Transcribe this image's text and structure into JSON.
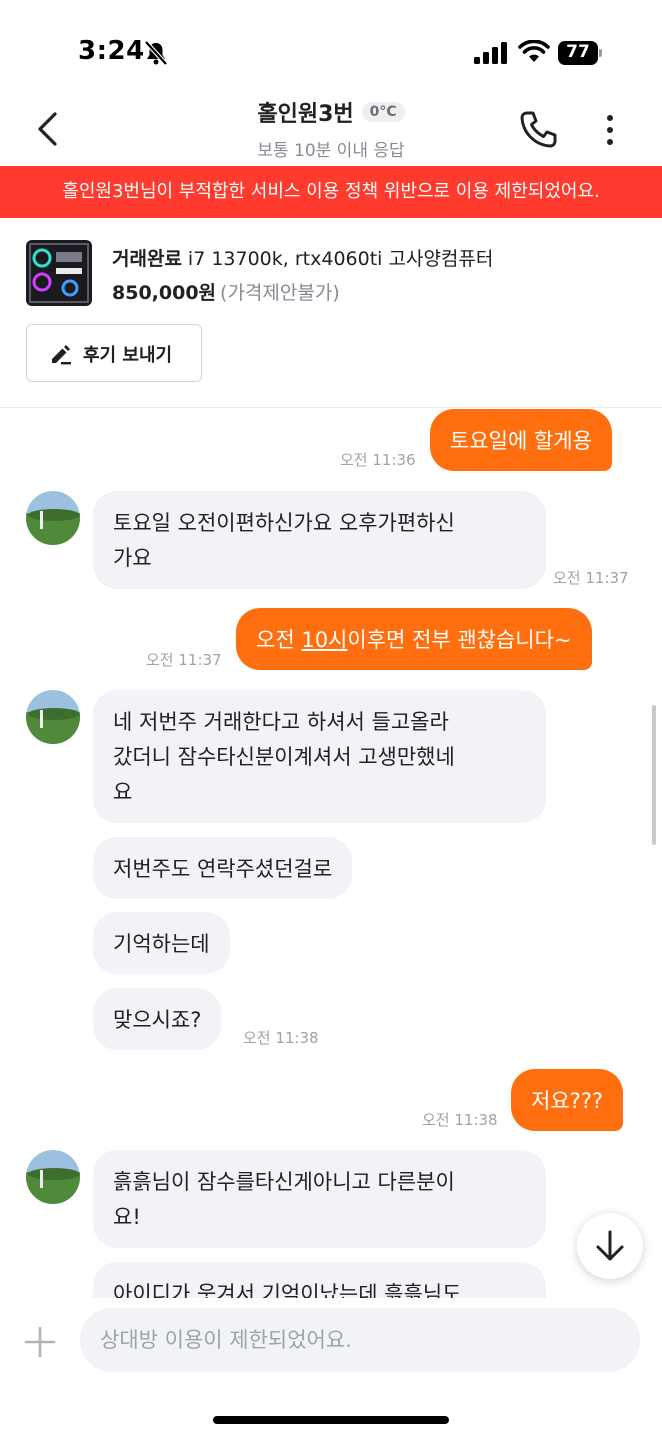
{
  "status_bar": {
    "time": "3:24",
    "battery": "77",
    "icons": [
      "bell-off-icon",
      "signal-icon",
      "wifi-icon",
      "battery-icon"
    ]
  },
  "header": {
    "title": "홀인원3번",
    "temperature": "0°C",
    "subtitle": "보통 10분 이내 응답",
    "icons": [
      "back-icon",
      "phone-icon",
      "more-vertical-icon"
    ]
  },
  "banner": {
    "text": "홀인원3번님이 부적합한 서비스 이용 정책 위반으로 이용 제한되었어요.",
    "color": "#ff3b2f"
  },
  "product": {
    "status": "거래완료",
    "title": "i7 13700k, rtx4060ti 고사양컴퓨터",
    "price": "850,000원",
    "price_note": "(가격제안불가)",
    "review_button": "후기 보내기"
  },
  "messages": [
    {
      "side": "out",
      "text": "토요일에 할게용",
      "time": "오전 11:36"
    },
    {
      "side": "in",
      "lines": [
        "토요일 오전이편하신가요 오후가편하신",
        "가요"
      ],
      "time": "오전 11:37"
    },
    {
      "side": "out",
      "text_before": "오전 ",
      "text_link": "10시",
      "text_after": "이후면 전부 괜찮습니다~",
      "time": "오전 11:37"
    },
    {
      "side": "in",
      "lines": [
        "네 저번주 거래한다고 하셔서 들고올라",
        "갔더니 잠수타신분이계셔서 고생만했네",
        "요"
      ]
    },
    {
      "side": "in",
      "text": "저번주도 연락주셨던걸로"
    },
    {
      "side": "in",
      "text": "기억하는데"
    },
    {
      "side": "in",
      "text": "맞으시죠?",
      "time": "오전 11:38"
    },
    {
      "side": "out",
      "text": "저요???",
      "time": "오전 11:38"
    },
    {
      "side": "in",
      "lines": [
        "흙흙님이 잠수를타신게아니고 다른분이",
        "요!"
      ]
    },
    {
      "side": "in",
      "text": "아이디가 웃겨서 기억이났는데 흙흙님도"
    }
  ],
  "input": {
    "placeholder": "상대방 이용이 제한되었어요."
  },
  "colors": {
    "accent": "#ff6f0f",
    "incoming_bubble": "#f2f3f6",
    "banner": "#ff3b2f"
  }
}
